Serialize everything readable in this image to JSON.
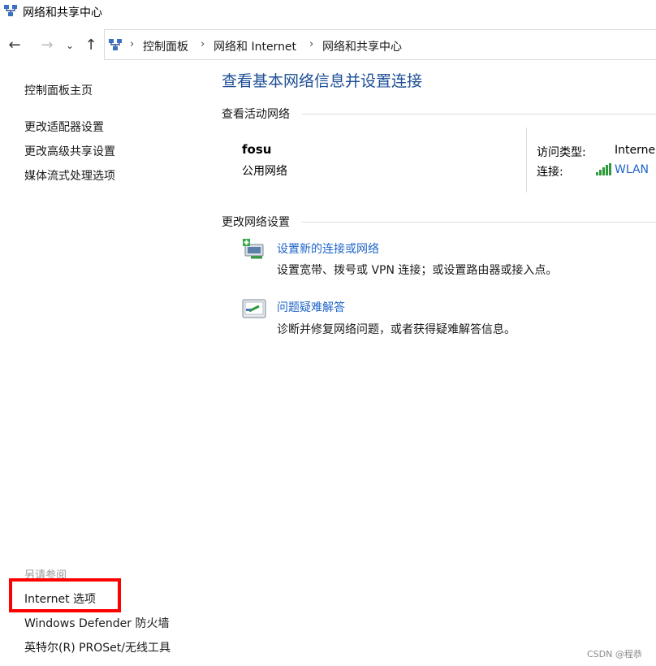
{
  "window": {
    "title": "网络和共享中心"
  },
  "nav": {
    "back": "←",
    "forward": "→",
    "recent": "⌄",
    "up": "↑"
  },
  "address": {
    "crumbs": [
      "控制面板",
      "网络和 Internet",
      "网络和共享中心"
    ],
    "separator": "›"
  },
  "left_pane": {
    "home": "控制面板主页",
    "links": [
      "更改适配器设置",
      "更改高级共享设置",
      "媒体流式处理选项"
    ],
    "see_also_title": "另请参阅",
    "see_also": [
      "Internet 选项",
      "Windows Defender 防火墙",
      "英特尔(R) PROSet/无线工具"
    ]
  },
  "main": {
    "heading": "查看基本网络信息并设置连接",
    "active_title": "查看活动网络",
    "network": {
      "name": "fosu",
      "category": "公用网络",
      "access_label": "访问类型:",
      "access_value": "Interne",
      "connection_label": "连接:",
      "connection_value": "WLAN"
    },
    "change_title": "更改网络设置",
    "tasks": [
      {
        "icon": "network-setup-icon",
        "link": "设置新的连接或网络",
        "desc": "设置宽带、拨号或 VPN 连接；或设置路由器或接入点。"
      },
      {
        "icon": "troubleshoot-icon",
        "link": "问题疑难解答",
        "desc": "诊断并修复网络问题，或者获得疑难解答信息。"
      }
    ]
  },
  "watermark": "CSDN @程恭",
  "colors": {
    "link": "#1e64c8",
    "heading": "#1e4f96",
    "highlight": "#ff0000"
  }
}
